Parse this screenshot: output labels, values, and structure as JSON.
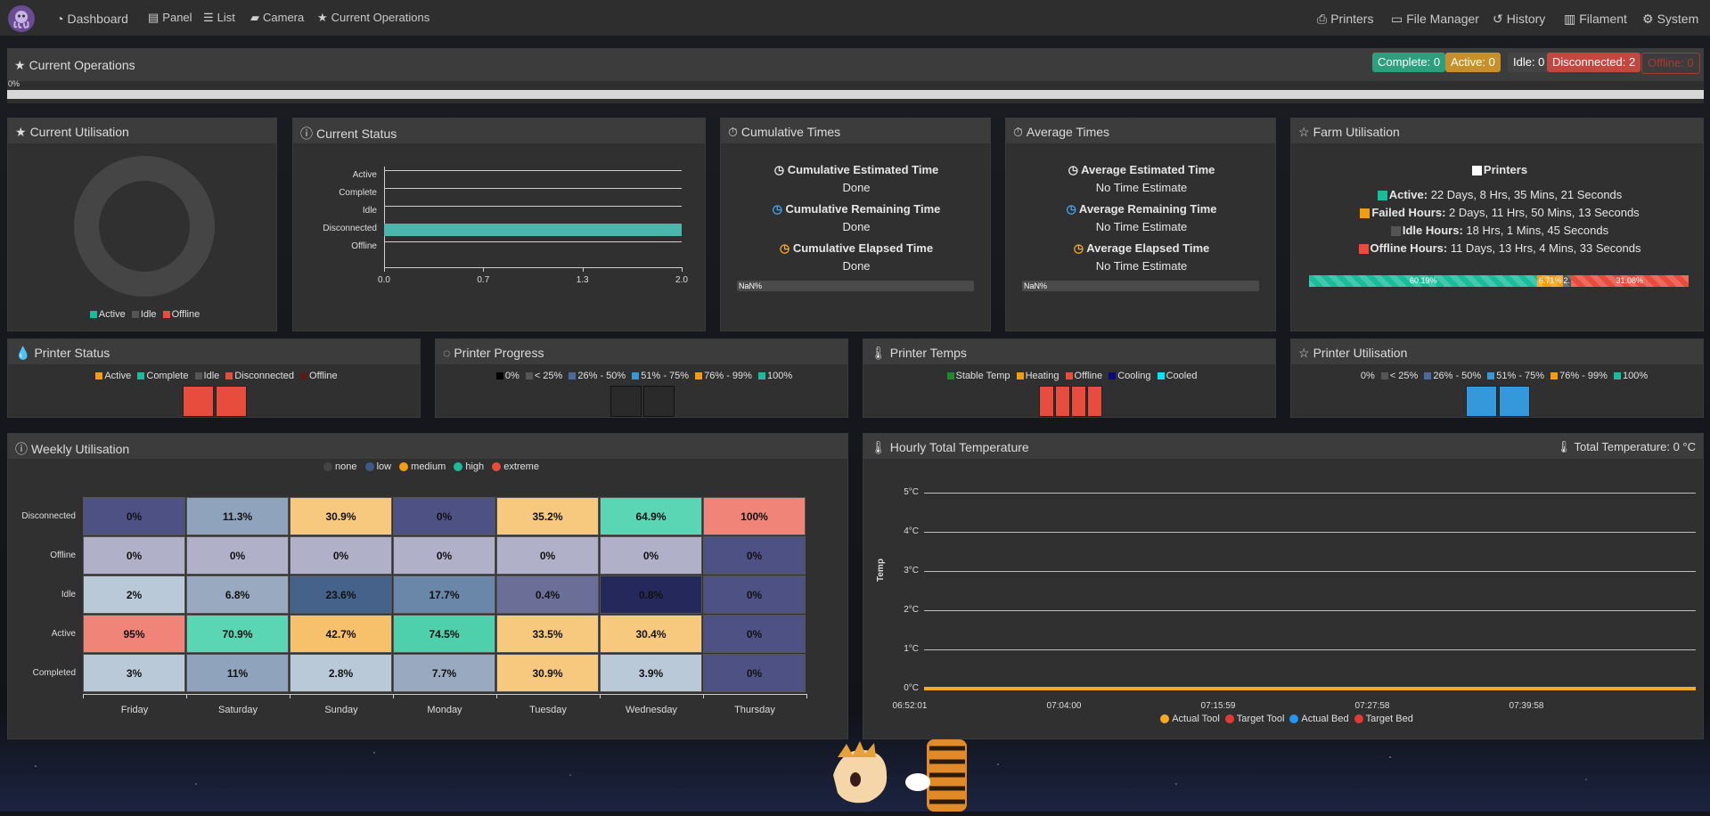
{
  "nav": {
    "left": [
      {
        "label": "Dashboard",
        "icon": "tachometer-icon"
      },
      {
        "label": "Panel",
        "icon": "panel-icon"
      },
      {
        "label": "List",
        "icon": "list-icon"
      },
      {
        "label": "Camera",
        "icon": "camera-icon"
      },
      {
        "label": "Current Operations",
        "icon": "star-icon"
      }
    ],
    "right": [
      {
        "label": "Printers",
        "icon": "printer-icon"
      },
      {
        "label": "File Manager",
        "icon": "folder-icon"
      },
      {
        "label": "History",
        "icon": "history-icon"
      },
      {
        "label": "Filament",
        "icon": "filament-icon"
      },
      {
        "label": "System",
        "icon": "gears-icon"
      }
    ]
  },
  "current_operations": {
    "title": "Current Operations",
    "progress_label": "0%",
    "progress": 0,
    "badges": {
      "complete": "Complete: 0",
      "active": "Active: 0",
      "idle": "Idle: 0",
      "disconnected": "Disconnected: 2",
      "offline": "Offline: 0"
    }
  },
  "current_utilisation": {
    "title": "Current Utilisation",
    "legend": [
      "Active",
      "Idle",
      "Offline"
    ]
  },
  "current_status": {
    "title": "Current Status",
    "chart_data": {
      "type": "bar",
      "orientation": "horizontal",
      "categories": [
        "Active",
        "Complete",
        "Idle",
        "Disconnected",
        "Offline"
      ],
      "values": [
        0,
        0,
        0,
        2,
        0
      ],
      "xlim": [
        0,
        2
      ],
      "ticks": [
        "0.0",
        "0.7",
        "1.3",
        "2.0"
      ],
      "bar_color": "#4db6ac"
    }
  },
  "cumulative_times": {
    "title": "Cumulative Times",
    "estimated_label": "Cumulative Estimated Time",
    "estimated_value": "Done",
    "remaining_label": "Cumulative Remaining Time",
    "remaining_value": "Done",
    "elapsed_label": "Cumulative Elapsed Time",
    "elapsed_value": "Done",
    "progress_label": "NaN%"
  },
  "average_times": {
    "title": "Average Times",
    "estimated_label": "Average Estimated Time",
    "estimated_value": "No Time Estimate",
    "remaining_label": "Average Remaining Time",
    "remaining_value": "No Time Estimate",
    "elapsed_label": "Average Elapsed Time",
    "elapsed_value": "No Time Estimate",
    "progress_label": "NaN%"
  },
  "farm_utilisation": {
    "title": "Farm Utilisation",
    "printers_label": "Printers",
    "active_label": "Active:",
    "active_value": "22 Days, 8 Hrs, 35 Mins, 21 Seconds",
    "failed_label": "Failed Hours:",
    "failed_value": "2 Days, 11 Hrs, 50 Mins, 13 Seconds",
    "idle_label": "Idle Hours:",
    "idle_value": "18 Hrs, 1 Mins, 45 Seconds",
    "offline_label": "Offline Hours:",
    "offline_value": "11 Days, 13 Hrs, 4 Mins, 33 Seconds",
    "bar": {
      "active_pct": 60.19,
      "active_label": "60.19%",
      "failed_pct": 6.71,
      "failed_label": "6.71%",
      "idle_pct": 2.02,
      "idle_label": "2.",
      "offline_pct": 31.08,
      "offline_label": "31.08%"
    }
  },
  "printer_status": {
    "title": "Printer Status",
    "legend": [
      "Active",
      "Complete",
      "Idle",
      "Disconnected",
      "Offline"
    ],
    "tile_count": 2
  },
  "printer_progress": {
    "title": "Printer Progress",
    "legend": [
      "0%",
      "< 25%",
      "26% - 50%",
      "51% - 75%",
      "76% - 99%",
      "100%"
    ],
    "tile_count": 2
  },
  "printer_temps": {
    "title": "Printer Temps",
    "legend": [
      "Stable Temp",
      "Heating",
      "Offline",
      "Cooling",
      "Cooled"
    ],
    "tile_count": 4
  },
  "printer_utilisation": {
    "title": "Printer Utilisation",
    "legend": [
      "0%",
      "< 25%",
      "26% - 50%",
      "51% - 75%",
      "76% - 99%",
      "100%"
    ],
    "tile_count": 2
  },
  "weekly_utilisation": {
    "title": "Weekly Utilisation",
    "legend": [
      "none",
      "low",
      "medium",
      "high",
      "extreme"
    ],
    "chart_data": {
      "type": "heatmap",
      "rows": [
        "Disconnected",
        "Offline",
        "Idle",
        "Active",
        "Completed"
      ],
      "columns": [
        "Friday",
        "Saturday",
        "Sunday",
        "Monday",
        "Tuesday",
        "Wednesday",
        "Thursday"
      ],
      "values": [
        [
          "0%",
          "11.3%",
          "30.9%",
          "0%",
          "35.2%",
          "64.9%",
          "100%"
        ],
        [
          "0%",
          "0%",
          "0%",
          "0%",
          "0%",
          "0%",
          "0%"
        ],
        [
          "2%",
          "6.8%",
          "23.6%",
          "17.7%",
          "0.4%",
          "0.8%",
          "0%"
        ],
        [
          "95%",
          "70.9%",
          "42.7%",
          "74.5%",
          "33.5%",
          "30.4%",
          "0%"
        ],
        [
          "3%",
          "11%",
          "2.8%",
          "7.7%",
          "30.9%",
          "3.9%",
          "0%"
        ]
      ],
      "colors": [
        [
          "#4d5184",
          "#8fa4bc",
          "#f7c97e",
          "#4d5184",
          "#f7c97e",
          "#5ad6b4",
          "#f08478"
        ],
        [
          "#b0b1c9",
          "#b0b1c9",
          "#b0b1c9",
          "#b0b1c9",
          "#b0b1c9",
          "#b0b1c9",
          "#4d5184"
        ],
        [
          "#b9c9d8",
          "#98a9c0",
          "#44628a",
          "#6a86a8",
          "#6b6f97",
          "#25285a",
          "#4d5184"
        ],
        [
          "#f08478",
          "#5ad6b4",
          "#f7c06a",
          "#4fd0ac",
          "#f7c97e",
          "#f7c97e",
          "#4d5184"
        ],
        [
          "#b9c9d8",
          "#8fa4bc",
          "#b9c9d8",
          "#98a9c0",
          "#f7c97e",
          "#b9c9d8",
          "#4d5184"
        ]
      ]
    }
  },
  "hourly_temperature": {
    "title": "Hourly Total Temperature",
    "total_label": "Total Temperature: 0 °C",
    "chart_data": {
      "type": "line",
      "ylabel": "Temp",
      "y_ticks": [
        "0°C",
        "1°C",
        "2°C",
        "3°C",
        "4°C",
        "5°C"
      ],
      "ylim": [
        0,
        5
      ],
      "x_ticks": [
        "06:52:01",
        "07:04:00",
        "07:15:59",
        "07:27:58",
        "07:39:58"
      ],
      "series": [
        {
          "name": "Actual Tool",
          "color": "#f9a825",
          "values": [
            0,
            0,
            0,
            0,
            0,
            0
          ]
        },
        {
          "name": "Target Tool",
          "color": "#e53935",
          "values": [
            0,
            0,
            0,
            0,
            0,
            0
          ]
        },
        {
          "name": "Actual Bed",
          "color": "#2196f3",
          "values": [
            0,
            0,
            0,
            0,
            0,
            0
          ]
        },
        {
          "name": "Target Bed",
          "color": "#e53935",
          "values": [
            0,
            0,
            0,
            0,
            0,
            0
          ]
        }
      ]
    }
  }
}
